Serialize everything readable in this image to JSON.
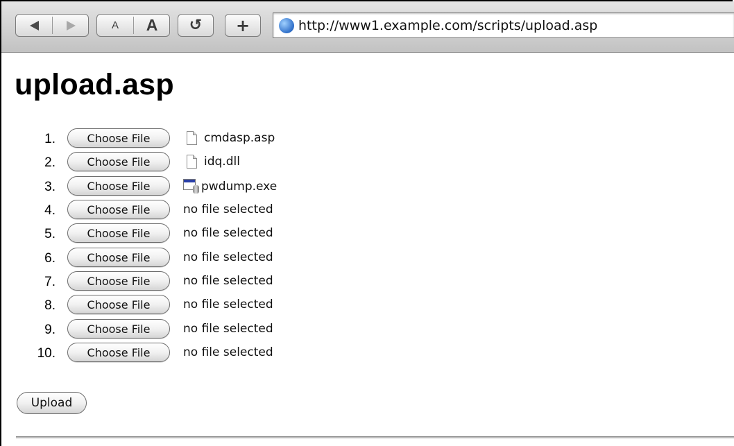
{
  "browser": {
    "address_url": "http://www1.example.com/scripts/upload.asp",
    "font_smaller_label": "A",
    "font_larger_label": "A",
    "reload_glyph": "↺",
    "add_glyph": "+"
  },
  "page": {
    "heading": "upload.asp",
    "upload_label": "Upload"
  },
  "file_inputs": [
    {
      "number": "1.",
      "button_label": "Choose File",
      "file_name": "cmdasp.asp",
      "icon": "document-icon"
    },
    {
      "number": "2.",
      "button_label": "Choose File",
      "file_name": "idq.dll",
      "icon": "document-icon"
    },
    {
      "number": "3.",
      "button_label": "Choose File",
      "file_name": "pwdump.exe",
      "icon": "executable-icon"
    },
    {
      "number": "4.",
      "button_label": "Choose File",
      "file_name": "no file selected",
      "icon": ""
    },
    {
      "number": "5.",
      "button_label": "Choose File",
      "file_name": "no file selected",
      "icon": ""
    },
    {
      "number": "6.",
      "button_label": "Choose File",
      "file_name": "no file selected",
      "icon": ""
    },
    {
      "number": "7.",
      "button_label": "Choose File",
      "file_name": "no file selected",
      "icon": ""
    },
    {
      "number": "8.",
      "button_label": "Choose File",
      "file_name": "no file selected",
      "icon": ""
    },
    {
      "number": "9.",
      "button_label": "Choose File",
      "file_name": "no file selected",
      "icon": ""
    },
    {
      "number": "10.",
      "button_label": "Choose File",
      "file_name": "no file selected",
      "icon": ""
    }
  ]
}
